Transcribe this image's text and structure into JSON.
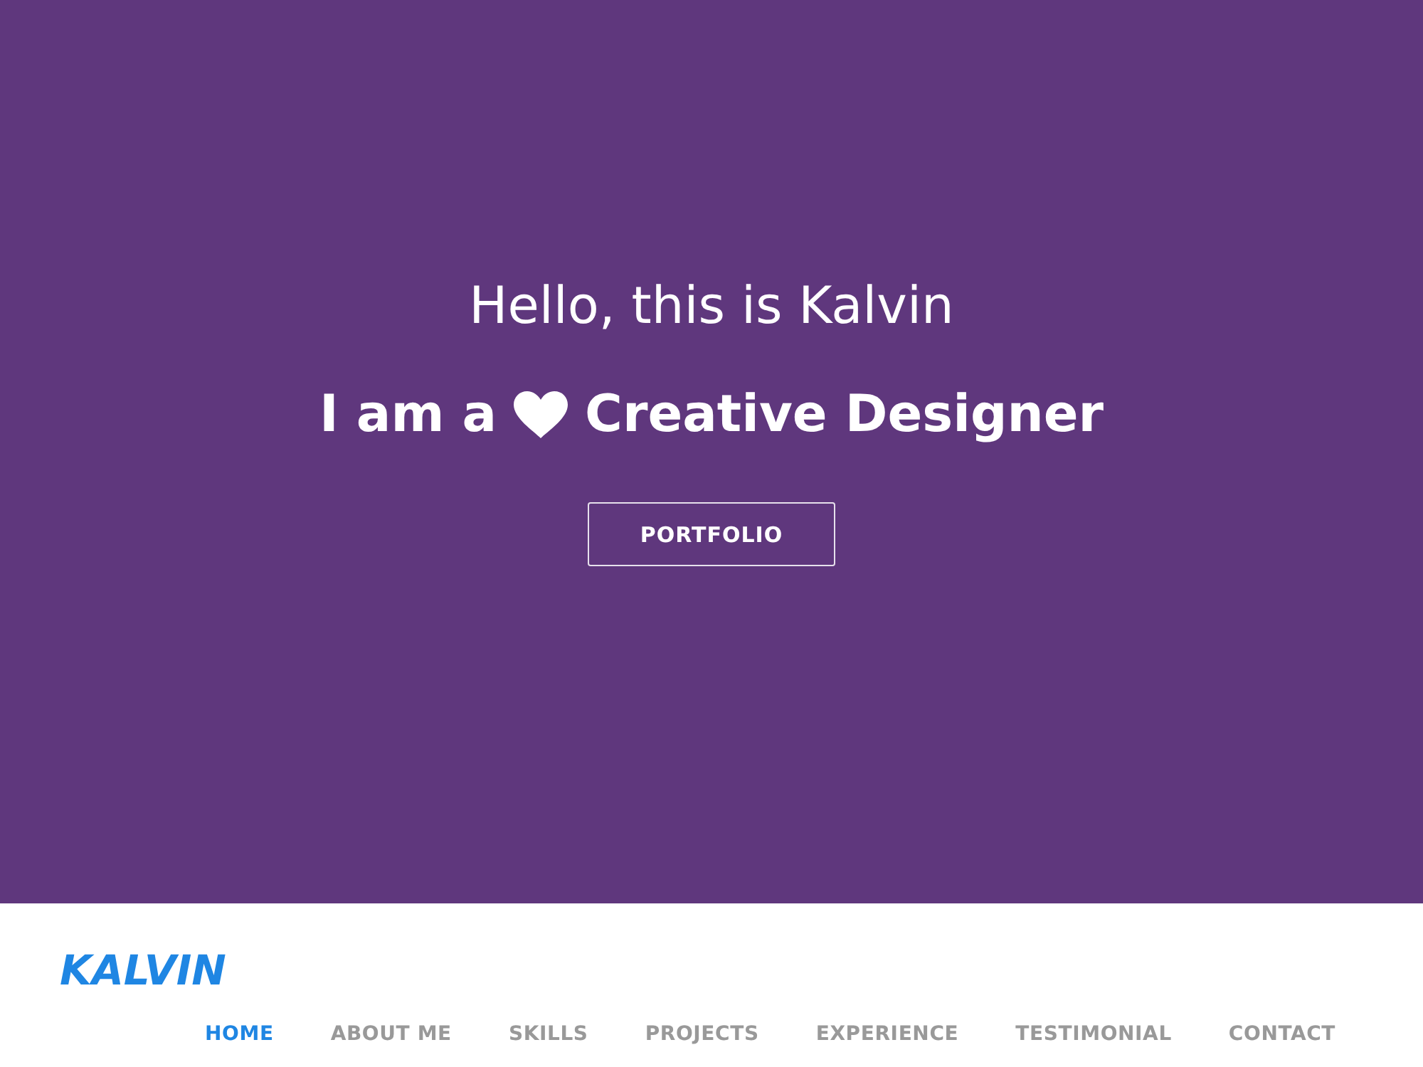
{
  "hero": {
    "greeting": "Hello, this is Kalvin",
    "headline": {
      "lead": "I am a",
      "role": "Creative Designer"
    },
    "button": "PORTFOLIO"
  },
  "header": {
    "logo": "KALVIN",
    "nav": [
      {
        "label": "HOME",
        "selected": true
      },
      {
        "label": "ABOUT ME",
        "selected": false
      },
      {
        "label": "SKILLS",
        "selected": false
      },
      {
        "label": "PROJECTS",
        "selected": false
      },
      {
        "label": "EXPERIENCE",
        "selected": false
      },
      {
        "label": "TESTIMONIAL",
        "selected": false
      },
      {
        "label": "CONTACT",
        "selected": false
      }
    ]
  }
}
